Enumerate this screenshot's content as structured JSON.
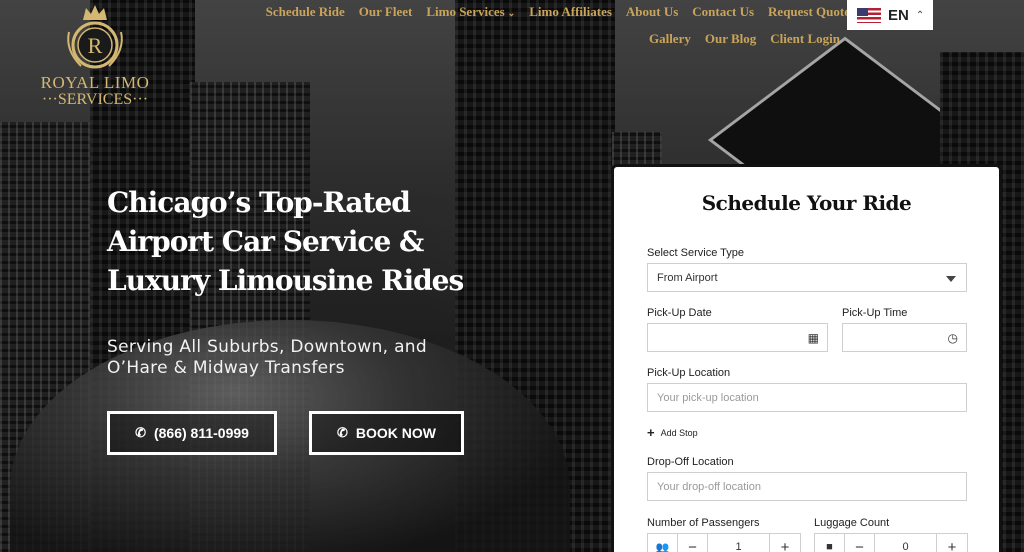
{
  "logo": {
    "emblem_letter": "R",
    "name": "ROYAL LIMO",
    "sub": "SERVICES"
  },
  "nav": {
    "row1": [
      {
        "label": "Schedule Ride",
        "dropdown": false
      },
      {
        "label": "Our Fleet",
        "dropdown": false
      },
      {
        "label": "Limo Services",
        "dropdown": true
      },
      {
        "label": "Limo Affiliates",
        "dropdown": false
      },
      {
        "label": "About Us",
        "dropdown": false
      },
      {
        "label": "Contact Us",
        "dropdown": false
      },
      {
        "label": "Request Quote",
        "dropdown": false
      }
    ],
    "row2": [
      {
        "label": "Gallery"
      },
      {
        "label": "Our Blog"
      },
      {
        "label": "Client Login"
      }
    ],
    "language": {
      "code": "EN",
      "flag": "us-flag-icon",
      "caret": "chevron-up-icon"
    }
  },
  "hero": {
    "title_lines": [
      "Chicago’s Top-Rated",
      "Airport Car Service &",
      "Luxury Limousine Rides"
    ],
    "subtitle_lines": [
      "Serving All Suburbs, Downtown, and",
      "O’Hare & Midway Transfers"
    ],
    "call_button": "(866) 811-0999",
    "book_button": "BOOK NOW"
  },
  "form": {
    "title": "Schedule Your Ride",
    "service_type": {
      "label": "Select Service Type",
      "value": "From Airport"
    },
    "pickup_date": {
      "label": "Pick-Up Date",
      "value": ""
    },
    "pickup_time": {
      "label": "Pick-Up Time",
      "value": ""
    },
    "pickup_location": {
      "label": "Pick-Up Location",
      "placeholder": "Your pick-up location"
    },
    "add_stop": "Add Stop",
    "dropoff_location": {
      "label": "Drop-Off Location",
      "placeholder": "Your drop-off location"
    },
    "passengers": {
      "label": "Number of Passengers",
      "value": "1"
    },
    "luggage": {
      "label": "Luggage Count",
      "value": "0"
    }
  },
  "colors": {
    "nav_gold": "#c9a45a",
    "logo_gold": "#d4b872",
    "form_border": "#111111"
  }
}
